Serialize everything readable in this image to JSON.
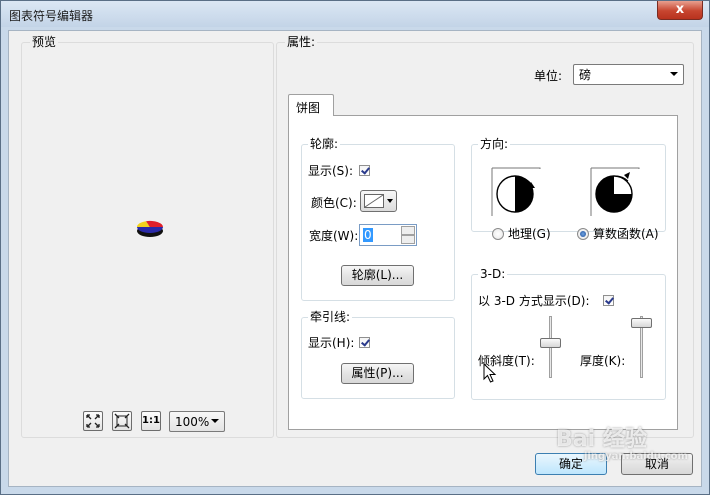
{
  "window": {
    "title": "图表符号编辑器",
    "close_glyph": "x"
  },
  "preview": {
    "label": "预览",
    "zoom_value": "100%",
    "one_to_one": "1:1"
  },
  "properties": {
    "label": "属性:",
    "unit_label": "单位:",
    "unit_value": "磅",
    "tab_label": "饼图",
    "outline": {
      "group_label": "轮廓:",
      "show_label": "显示(S):",
      "color_label": "颜色(C):",
      "width_label": "宽度(W):",
      "width_value": "0",
      "button_label": "轮廓(L)..."
    },
    "leader": {
      "group_label": "牵引线:",
      "show_label": "显示(H):",
      "button_label": "属性(P)..."
    },
    "direction": {
      "group_label": "方向:",
      "geographic_label": "地理(G)",
      "arithmetic_label": "算数函数(A)"
    },
    "three_d": {
      "group_label": "3-D:",
      "show_label": "以 3-D 方式显示(D):",
      "tilt_label": "倾斜度(T):",
      "thickness_label": "厚度(K):"
    }
  },
  "footer": {
    "ok_label": "确定",
    "cancel_label": "取消"
  },
  "watermark": {
    "text": "Bai 经验",
    "subtext": "jingyan.baidu.com"
  },
  "colors": {
    "pie_yellow": "#f2d21b",
    "pie_red": "#e0202a",
    "pie_blue": "#2a2aa8",
    "ok_border": "#3c7fb1"
  }
}
